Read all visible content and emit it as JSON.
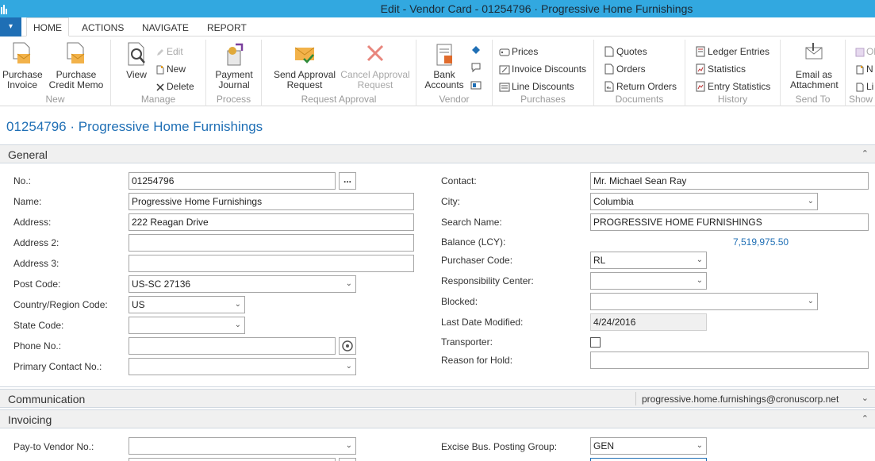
{
  "window": {
    "title": "Edit - Vendor Card - 01254796 · Progressive Home Furnishings"
  },
  "tabs": [
    {
      "label": "HOME",
      "active": true
    },
    {
      "label": "ACTIONS"
    },
    {
      "label": "NAVIGATE"
    },
    {
      "label": "REPORT"
    }
  ],
  "ribbon": {
    "new": {
      "label": "New",
      "purchase_invoice": "Purchase\nInvoice",
      "purchase_credit_memo": "Purchase\nCredit Memo"
    },
    "manage": {
      "label": "Manage",
      "view": "View",
      "edit": "Edit",
      "new": "New",
      "delete": "Delete"
    },
    "process": {
      "label": "Process",
      "payment_journal": "Payment\nJournal"
    },
    "request_approval": {
      "label": "Request Approval",
      "send": "Send Approval\nRequest",
      "cancel": "Cancel Approval\nRequest"
    },
    "vendor": {
      "label": "Vendor",
      "bank_accounts": "Bank\nAccounts"
    },
    "purchases": {
      "label": "Purchases",
      "prices": "Prices",
      "invoice_discounts": "Invoice Discounts",
      "line_discounts": "Line Discounts"
    },
    "documents": {
      "label": "Documents",
      "quotes": "Quotes",
      "orders": "Orders",
      "return_orders": "Return Orders"
    },
    "history": {
      "label": "History",
      "ledger_entries": "Ledger Entries",
      "statistics": "Statistics",
      "entry_statistics": "Entry Statistics"
    },
    "send_to": {
      "label": "Send To",
      "email": "Email as\nAttachment"
    },
    "show": {
      "label": "Show",
      "item1": "Ol",
      "item2": "N",
      "item3": "Li"
    }
  },
  "page_title": "01254796 · Progressive Home Furnishings",
  "general": {
    "title": "General",
    "left": {
      "no": {
        "label": "No.:",
        "value": "01254796",
        "assist": "..."
      },
      "name": {
        "label": "Name:",
        "value": "Progressive Home Furnishings"
      },
      "address": {
        "label": "Address:",
        "value": "222 Reagan Drive"
      },
      "address2": {
        "label": "Address 2:",
        "value": ""
      },
      "address3": {
        "label": "Address 3:",
        "value": ""
      },
      "post_code": {
        "label": "Post Code:",
        "value": "US-SC 27136"
      },
      "country": {
        "label": "Country/Region Code:",
        "value": "US"
      },
      "state": {
        "label": "State Code:",
        "value": ""
      },
      "phone": {
        "label": "Phone No.:",
        "value": ""
      },
      "primary_contact": {
        "label": "Primary Contact No.:",
        "value": ""
      }
    },
    "right": {
      "contact": {
        "label": "Contact:",
        "value": "Mr. Michael Sean Ray"
      },
      "city": {
        "label": "City:",
        "value": "Columbia"
      },
      "search_name": {
        "label": "Search Name:",
        "value": "PROGRESSIVE HOME FURNISHINGS"
      },
      "balance": {
        "label": "Balance (LCY):",
        "value": "7,519,975.50"
      },
      "purchaser": {
        "label": "Purchaser Code:",
        "value": "RL"
      },
      "resp_center": {
        "label": "Responsibility Center:",
        "value": ""
      },
      "blocked": {
        "label": "Blocked:",
        "value": ""
      },
      "last_modified": {
        "label": "Last Date Modified:",
        "value": "4/24/2016"
      },
      "transporter": {
        "label": "Transporter:",
        "checked": false
      },
      "reason_hold": {
        "label": "Reason for Hold:",
        "value": ""
      }
    }
  },
  "communication": {
    "title": "Communication",
    "summary": "progressive.home.furnishings@cronuscorp.net"
  },
  "invoicing": {
    "title": "Invoicing",
    "pay_to": {
      "label": "Pay-to Vendor No.:",
      "value": ""
    },
    "excise": {
      "label": "Excise Bus. Posting Group:",
      "value": "GEN"
    }
  },
  "glyphs": {
    "dropdown": "⌄",
    "expanded": "⌃",
    "collapsed": "⌄",
    "menu": "▾"
  }
}
